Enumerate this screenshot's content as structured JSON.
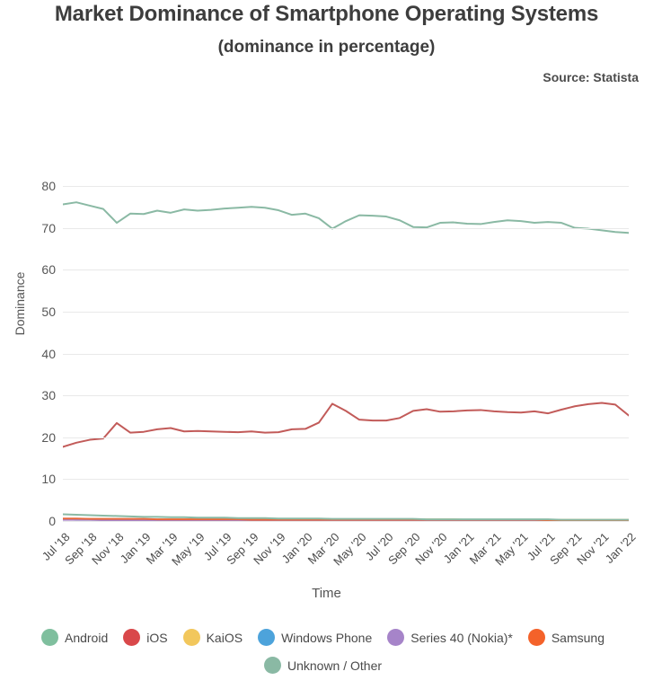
{
  "header": {
    "title": "Market Dominance of Smartphone Operating Systems",
    "subtitle": "(dominance in percentage)",
    "source": "Source: Statista"
  },
  "axes": {
    "y_title": "Dominance",
    "x_title": "Time"
  },
  "legend": {
    "row1": [
      {
        "label": "Android",
        "color": "#7fbf9e"
      },
      {
        "label": "iOS",
        "color": "#d9484a"
      },
      {
        "label": "KaiOS",
        "color": "#f2c75c"
      },
      {
        "label": "Windows Phone",
        "color": "#4da3db"
      },
      {
        "label": "Series 40 (Nokia)*",
        "color": "#a684c9"
      },
      {
        "label": "Samsung",
        "color": "#f4622a"
      }
    ],
    "row2": [
      {
        "label": "Unknown / Other",
        "color": "#8ab9a4"
      }
    ]
  },
  "chart_data": {
    "type": "line",
    "title": "Market Dominance of Smartphone Operating Systems",
    "subtitle": "(dominance in percentage)",
    "source": "Source: Statista",
    "xlabel": "Time",
    "ylabel": "Dominance",
    "ylim": [
      0,
      80
    ],
    "yticks": [
      0,
      10,
      20,
      30,
      40,
      50,
      60,
      70,
      80
    ],
    "grid": true,
    "legend_position": "bottom",
    "x_tick_labels": [
      "Jul '18",
      "Sep '18",
      "Nov '18",
      "Jan '19",
      "Mar '19",
      "May '19",
      "Jul '19",
      "Sep '19",
      "Nov '19",
      "Jan '20",
      "Mar '20",
      "May '20",
      "Jul '20",
      "Sep '20",
      "Nov '20",
      "Jan '21",
      "Mar '21",
      "May '21",
      "Jul '21",
      "Sep '21",
      "Nov '21",
      "Jan '22"
    ],
    "x": [
      "Jul '18",
      "Aug '18",
      "Sep '18",
      "Oct '18",
      "Nov '18",
      "Dec '18",
      "Jan '19",
      "Feb '19",
      "Mar '19",
      "Apr '19",
      "May '19",
      "Jun '19",
      "Jul '19",
      "Aug '19",
      "Sep '19",
      "Oct '19",
      "Nov '19",
      "Dec '19",
      "Jan '20",
      "Feb '20",
      "Mar '20",
      "Apr '20",
      "May '20",
      "Jun '20",
      "Jul '20",
      "Aug '20",
      "Sep '20",
      "Oct '20",
      "Nov '20",
      "Dec '20",
      "Jan '21",
      "Feb '21",
      "Mar '21",
      "Apr '21",
      "May '21",
      "Jun '21",
      "Jul '21",
      "Aug '21",
      "Sep '21",
      "Oct '21",
      "Nov '21",
      "Dec '21",
      "Jan '22"
    ],
    "series": [
      {
        "name": "Android",
        "color": "#8ab9a4",
        "values": [
          75.6,
          76.1,
          75.3,
          74.5,
          71.2,
          73.4,
          73.3,
          74.1,
          73.6,
          74.4,
          74.1,
          74.3,
          74.6,
          74.8,
          75.0,
          74.8,
          74.2,
          73.1,
          73.4,
          72.3,
          69.8,
          71.6,
          73.0,
          72.9,
          72.7,
          71.8,
          70.2,
          70.1,
          71.2,
          71.3,
          71.0,
          70.9,
          71.4,
          71.8,
          71.6,
          71.2,
          71.4,
          71.2,
          70.0,
          69.8,
          69.4,
          69.0,
          68.8
        ]
      },
      {
        "name": "iOS",
        "color": "#c25b59",
        "values": [
          17.7,
          18.7,
          19.4,
          19.7,
          23.4,
          21.1,
          21.3,
          21.9,
          22.2,
          21.4,
          21.5,
          21.4,
          21.3,
          21.2,
          21.4,
          21.1,
          21.2,
          21.9,
          22.0,
          23.5,
          28.0,
          26.3,
          24.2,
          24.0,
          24.0,
          24.6,
          26.3,
          26.7,
          26.1,
          26.2,
          26.4,
          26.5,
          26.2,
          26.0,
          25.9,
          26.2,
          25.7,
          26.6,
          27.4,
          27.9,
          28.2,
          27.8,
          25.2
        ]
      },
      {
        "name": "KaiOS",
        "color": "#efc55d",
        "values": [
          0.5,
          0.5,
          0.5,
          0.5,
          0.4,
          0.4,
          0.4,
          0.4,
          0.4,
          0.4,
          0.4,
          0.4,
          0.4,
          0.4,
          0.4,
          0.4,
          0.4,
          0.4,
          0.5,
          0.5,
          0.4,
          0.4,
          0.4,
          0.4,
          0.4,
          0.4,
          0.4,
          0.4,
          0.4,
          0.4,
          0.3,
          0.3,
          0.3,
          0.3,
          0.3,
          0.3,
          0.3,
          0.3,
          0.3,
          0.3,
          0.3,
          0.3,
          0.3
        ]
      },
      {
        "name": "Windows Phone",
        "color": "#5fa8d6",
        "values": [
          0.4,
          0.3,
          0.3,
          0.3,
          0.3,
          0.3,
          0.2,
          0.2,
          0.2,
          0.2,
          0.2,
          0.2,
          0.1,
          0.1,
          0.1,
          0.1,
          0.1,
          0.1,
          0.1,
          0.1,
          0.1,
          0.1,
          0.1,
          0.1,
          0.1,
          0.1,
          0.1,
          0.1,
          0.1,
          0.1,
          0.0,
          0.0,
          0.0,
          0.0,
          0.0,
          0.0,
          0.0,
          0.0,
          0.0,
          0.0,
          0.0,
          0.0,
          0.0
        ]
      },
      {
        "name": "Series 40 (Nokia)*",
        "color": "#a684c9",
        "values": [
          0.3,
          0.3,
          0.3,
          0.2,
          0.2,
          0.2,
          0.2,
          0.2,
          0.2,
          0.2,
          0.2,
          0.1,
          0.1,
          0.1,
          0.1,
          0.1,
          0.1,
          0.1,
          0.1,
          0.1,
          0.1,
          0.1,
          0.1,
          0.1,
          0.1,
          0.1,
          0.1,
          0.1,
          0.1,
          0.1,
          0.0,
          0.0,
          0.0,
          0.0,
          0.0,
          0.0,
          0.0,
          0.0,
          0.0,
          0.0,
          0.0,
          0.0,
          0.0
        ]
      },
      {
        "name": "Samsung",
        "color": "#e8683b",
        "values": [
          0.6,
          0.6,
          0.5,
          0.5,
          0.5,
          0.5,
          0.5,
          0.4,
          0.4,
          0.4,
          0.4,
          0.4,
          0.4,
          0.4,
          0.3,
          0.3,
          0.3,
          0.3,
          0.3,
          0.3,
          0.3,
          0.3,
          0.3,
          0.3,
          0.3,
          0.3,
          0.3,
          0.3,
          0.3,
          0.3,
          0.3,
          0.3,
          0.3,
          0.3,
          0.3,
          0.3,
          0.2,
          0.2,
          0.2,
          0.2,
          0.2,
          0.2,
          0.2
        ]
      },
      {
        "name": "Unknown / Other",
        "color": "#8ab9a4",
        "values": [
          1.6,
          1.5,
          1.4,
          1.3,
          1.2,
          1.1,
          1.0,
          1.0,
          0.9,
          0.9,
          0.8,
          0.8,
          0.8,
          0.7,
          0.7,
          0.7,
          0.6,
          0.6,
          0.6,
          0.6,
          0.5,
          0.5,
          0.5,
          0.5,
          0.5,
          0.5,
          0.5,
          0.4,
          0.4,
          0.4,
          0.4,
          0.4,
          0.4,
          0.4,
          0.4,
          0.4,
          0.4,
          0.3,
          0.3,
          0.3,
          0.3,
          0.3,
          0.3
        ]
      }
    ]
  }
}
